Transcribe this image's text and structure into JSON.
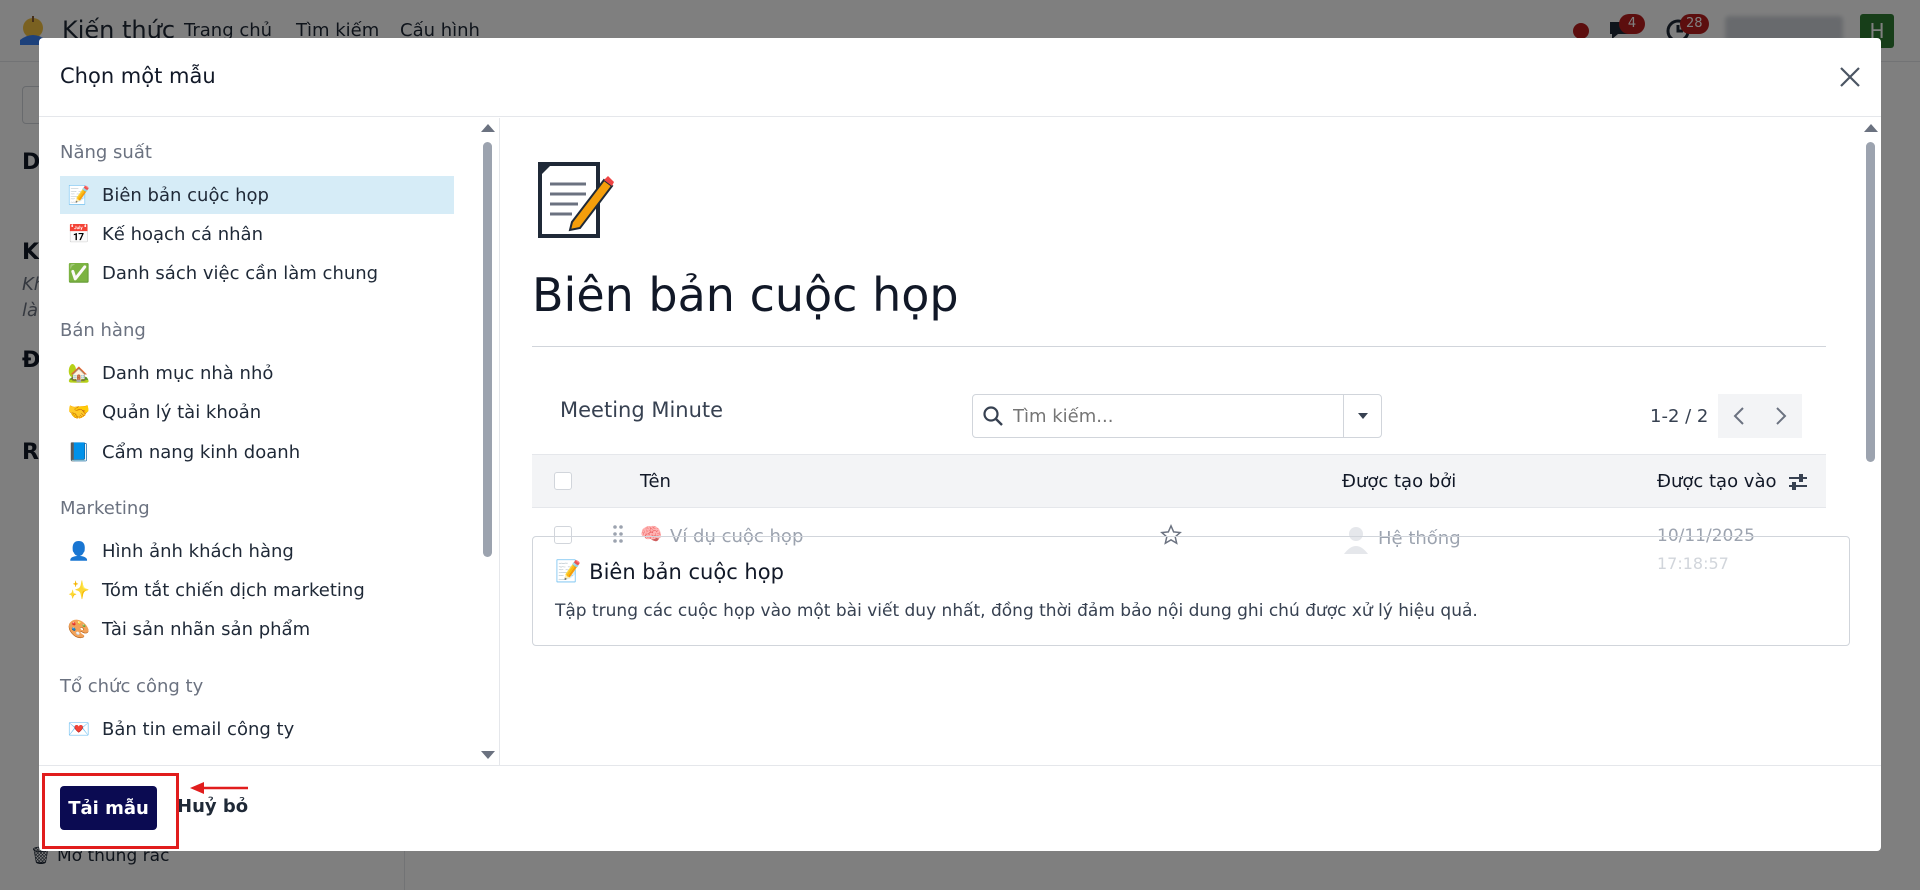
{
  "app": {
    "name": "Kiến thức",
    "nav": [
      "Trang chủ",
      "Tìm kiếm",
      "Cấu hình"
    ],
    "messages_count": "4",
    "activities_count": "28",
    "avatar_letter": "H",
    "trash_label": "Mở thùng rác"
  },
  "background": {
    "letters": [
      "D",
      "K",
      "Đ",
      "Ri"
    ],
    "small": [
      "Kh",
      "là"
    ]
  },
  "modal": {
    "title": "Chọn một mẫu",
    "categories": [
      {
        "title": "Năng suất",
        "items": [
          {
            "label": "Biên bản cuộc họp",
            "icon": "memo-icon",
            "active": true
          },
          {
            "label": "Kế hoạch cá nhân",
            "icon": "calendar-icon"
          },
          {
            "label": "Danh sách việc cần làm chung",
            "icon": "check-box-icon"
          }
        ]
      },
      {
        "title": "Bán hàng",
        "items": [
          {
            "label": "Danh mục nhà nhỏ",
            "icon": "house-icon"
          },
          {
            "label": "Quản lý tài khoản",
            "icon": "handshake-icon"
          },
          {
            "label": "Cẩm nang kinh doanh",
            "icon": "blue-book-icon"
          }
        ]
      },
      {
        "title": "Marketing",
        "items": [
          {
            "label": "Hình ảnh khách hàng",
            "icon": "person-icon"
          },
          {
            "label": "Tóm tắt chiến dịch marketing",
            "icon": "sparkles-icon"
          },
          {
            "label": "Tài sản nhãn sản phẩm",
            "icon": "palette-icon"
          }
        ]
      },
      {
        "title": "Tổ chức công ty",
        "items": [
          {
            "label": "Bản tin email công ty",
            "icon": "envelope-icon"
          }
        ]
      }
    ],
    "preview": {
      "title": "Biên bản cuộc họp",
      "list_title": "Meeting Minute",
      "search_placeholder": "Tìm kiếm...",
      "pager": "1-2 / 2",
      "columns": [
        "Tên",
        "Được tạo bởi",
        "Được tạo vào"
      ],
      "rows": [
        {
          "name": "Ví dụ cuộc họp",
          "created_by": "Hệ thống",
          "date": "10/11/2025",
          "time": "17:18:57"
        }
      ],
      "desc_title": "Biên bản cuộc họp",
      "desc_text": "Tập trung các cuộc họp vào một bài viết duy nhất, đồng thời đảm bảo nội dung ghi chú được xử lý hiệu quả."
    },
    "footer": {
      "primary": "Tải mẫu",
      "cancel": "Huỷ bỏ"
    }
  },
  "colors": {
    "primary": "#0b0b52",
    "active_bg": "#d6ecf7",
    "annotation": "#e11d1d",
    "badge": "#b91c1c",
    "avatar": "#2e7d32"
  }
}
